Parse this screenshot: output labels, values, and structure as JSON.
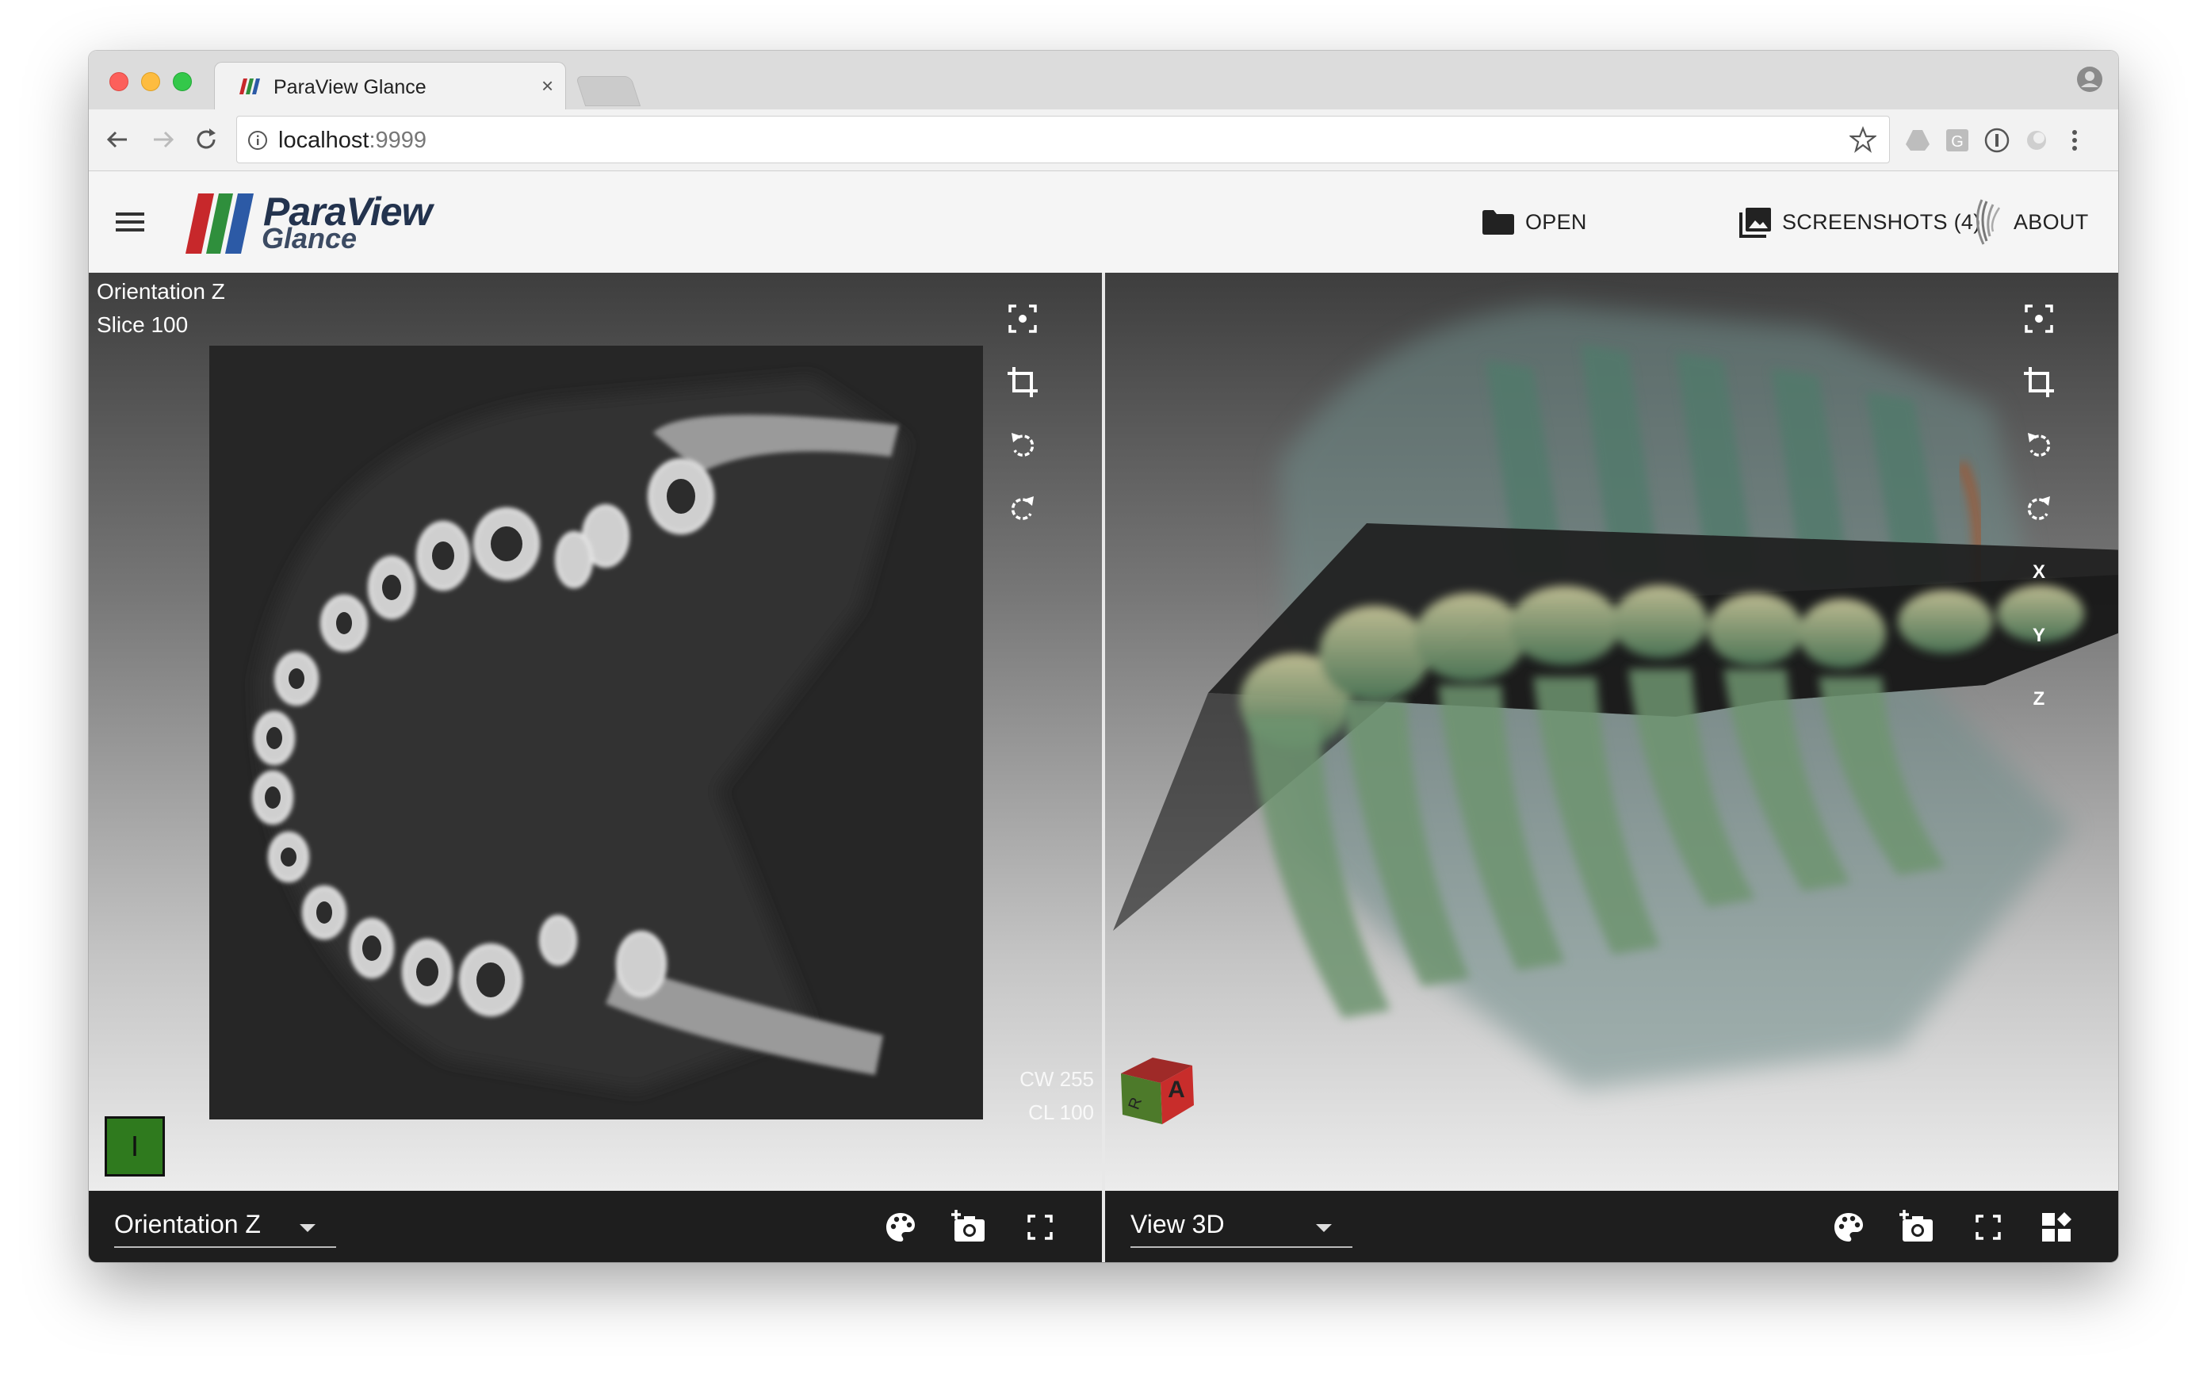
{
  "browser": {
    "tab_title": "ParaView Glance",
    "tab_close": "×",
    "url_host": "localhost",
    "url_port": ":9999"
  },
  "app": {
    "logo_line1": "ParaView",
    "logo_line2": "Glance",
    "menu": [
      {
        "label": "OPEN",
        "icon": "folder-icon"
      },
      {
        "label": "SCREENSHOTS (4)",
        "icon": "image-gallery-icon"
      },
      {
        "label": "ABOUT",
        "icon": "kitware-logo-icon"
      }
    ]
  },
  "left_view": {
    "orientation_label": "Orientation Z",
    "slice_label": "Slice 100",
    "cw": "CW 255",
    "cl": "CL 100",
    "marker_letter": "I",
    "marker_color": "#2f7a1e",
    "select_value": "Orientation Z",
    "tools": [
      "reset-camera-icon",
      "crop-icon",
      "rotate-left-icon",
      "rotate-right-icon"
    ],
    "bottom_icons": [
      "palette-icon",
      "camera-add-icon",
      "fullscreen-icon"
    ]
  },
  "right_view": {
    "select_value": "View 3D",
    "axes": [
      "X",
      "Y",
      "Z"
    ],
    "cube_labels": [
      "A",
      "R"
    ],
    "tools": [
      "reset-camera-icon",
      "crop-icon",
      "rotate-left-icon",
      "rotate-right-icon"
    ],
    "bottom_icons": [
      "palette-icon",
      "camera-add-icon",
      "fullscreen-icon",
      "layout-icon"
    ]
  },
  "colors": {
    "logo_red": "#c7282b",
    "logo_green": "#2f8f3c",
    "logo_blue": "#2c5aa6",
    "bottombar": "#1e1e1e"
  }
}
